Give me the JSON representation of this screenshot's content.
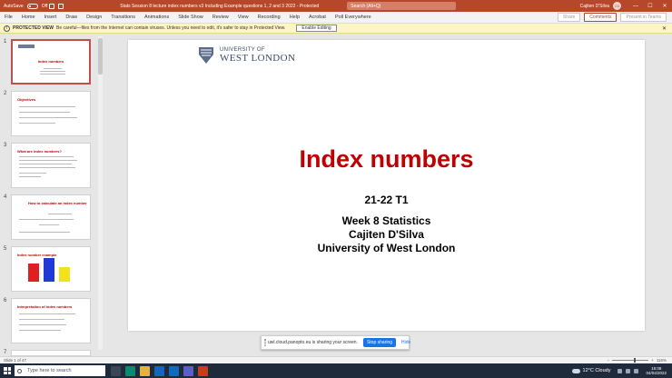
{
  "titlebar": {
    "autosave": "AutoSave",
    "autosave_state": "Off",
    "doc_title": "Stats Session 8 lecture index numbers v3 Including Example questions 1, 2 and 3 2022 - Protected View - Saved to this PC",
    "search_placeholder": "Search (Alt+Q)",
    "user_name": "Cajiten D'Silva",
    "user_initials": "CD",
    "minimize": "—",
    "maximize": "☐",
    "close": "✕"
  },
  "ribbon": {
    "tabs": [
      "File",
      "Home",
      "Insert",
      "Draw",
      "Design",
      "Transitions",
      "Animations",
      "Slide Show",
      "Review",
      "View",
      "Recording",
      "Help",
      "Acrobat",
      "Poll Everywhere"
    ],
    "share": "Share",
    "comments": "Comments",
    "present": "Present in Teams"
  },
  "protected_view": {
    "label": "PROTECTED VIEW",
    "message": "Be careful—files from the Internet can contain viruses. Unless you need to edit, it's safer to stay in Protected View.",
    "enable_button": "Enable Editing",
    "close": "✕"
  },
  "thumbnails": [
    {
      "num": "1",
      "title": "Index numbers"
    },
    {
      "num": "2",
      "title": "Objectives"
    },
    {
      "num": "3",
      "title": "What are index numbers?"
    },
    {
      "num": "4",
      "title": "How to calculate an index number"
    },
    {
      "num": "5",
      "title": "Index number example"
    },
    {
      "num": "6",
      "title": "Interpretation of index numbers"
    },
    {
      "num": "7",
      "title": ""
    }
  ],
  "slide": {
    "logo_univ_of": "UNIVERSITY OF",
    "logo_west_london": "WEST LONDON",
    "title": "Index numbers",
    "subtitle": "21-22 T1",
    "lines": [
      "Week 8 Statistics",
      "Cajiten D'Silva",
      "University of West London"
    ]
  },
  "share_bar": {
    "message": "uwl.cloud.panopto.eu is sharing your screen.",
    "stop_button": "Stop sharing",
    "hide_link": "Hide"
  },
  "status": {
    "slide_count": "Slide 1 of 47",
    "zoom": "116%"
  },
  "taskbar": {
    "search_placeholder": "Type here to search",
    "weather": "12°C  Cloudy",
    "time": "15:08",
    "date": "04/04/2022"
  },
  "colors": {
    "accent": "#b7472a",
    "title_red": "#c00000",
    "taskbar": "#1f2a3a"
  }
}
